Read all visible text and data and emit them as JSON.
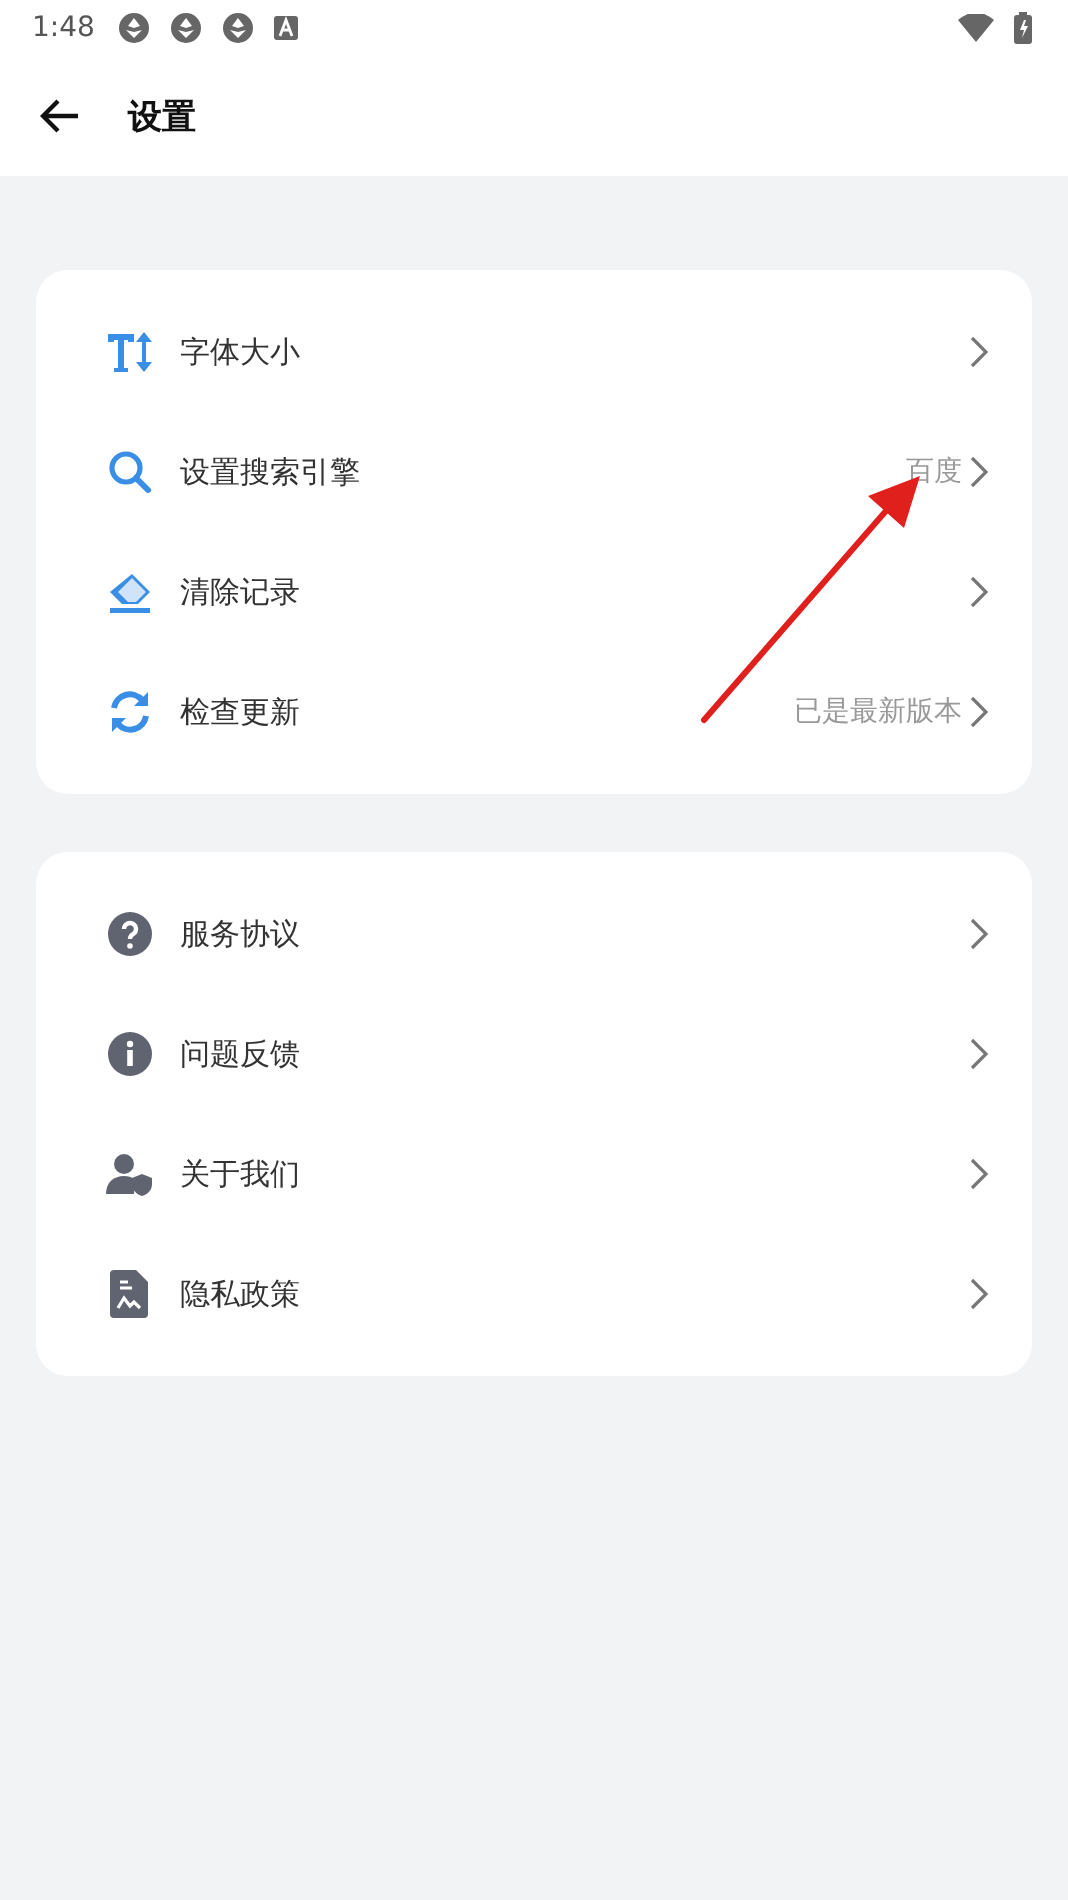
{
  "status_bar": {
    "time": "1:48"
  },
  "header": {
    "title": "设置"
  },
  "groups": [
    {
      "items": [
        {
          "label": "字体大小"
        },
        {
          "label": "设置搜索引擎",
          "value": "百度"
        },
        {
          "label": "清除记录"
        },
        {
          "label": "检查更新",
          "value": "已是最新版本"
        }
      ]
    },
    {
      "items": [
        {
          "label": "服务协议"
        },
        {
          "label": "问题反馈"
        },
        {
          "label": "关于我们"
        },
        {
          "label": "隐私政策"
        }
      ]
    }
  ],
  "annotation": {
    "kind": "arrow",
    "color": "#e0201c"
  }
}
